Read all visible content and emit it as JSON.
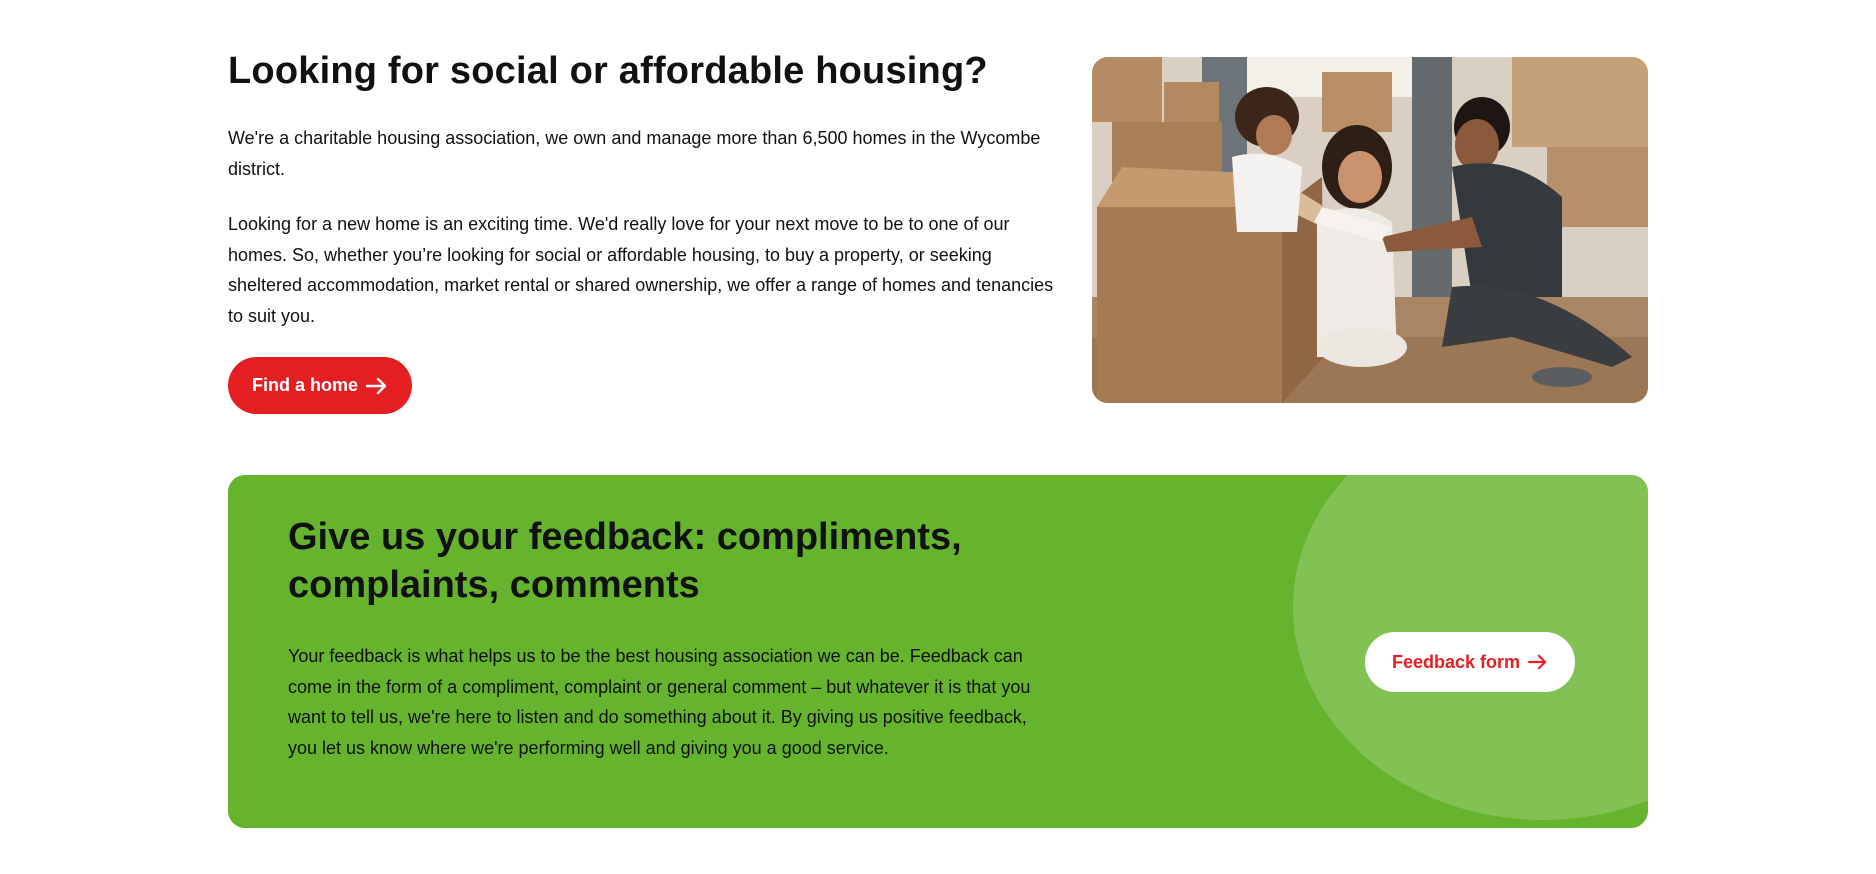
{
  "housing": {
    "title": "Looking for social or affordable housing?",
    "paragraph_1": "We're a charitable housing association, we own and manage more than 6,500 homes in the Wycombe district.",
    "paragraph_2": "Looking for a new home is an exciting time. We'd really love for your next move to be to one of our homes. So, whether you’re looking for social or affordable housing, to buy a property, or seeking sheltered accommodation, market rental or shared ownership, we offer a range of homes and tenancies to suit you.",
    "button_label": "Find a home",
    "button_icon": "arrow-right-icon",
    "button_color": "#e41f21",
    "photo_icon": "family-moving-boxes-photo"
  },
  "feedback": {
    "title": "Give us your feedback: compliments, complaints, comments",
    "paragraph": "Your feedback is what helps us to be the best housing association we can be. Feedback can come in the form of a compliment, complaint or general comment – but whatever it is that you want to tell us, we're here to listen and do something about it. By giving us positive feedback, you let us know where we're performing well and giving you a good service.",
    "button_label": "Feedback form",
    "button_icon": "arrow-right-icon",
    "background_color": "#66b32e",
    "accent_circle_color": "#82c153",
    "button_text_color": "#e41f21"
  }
}
